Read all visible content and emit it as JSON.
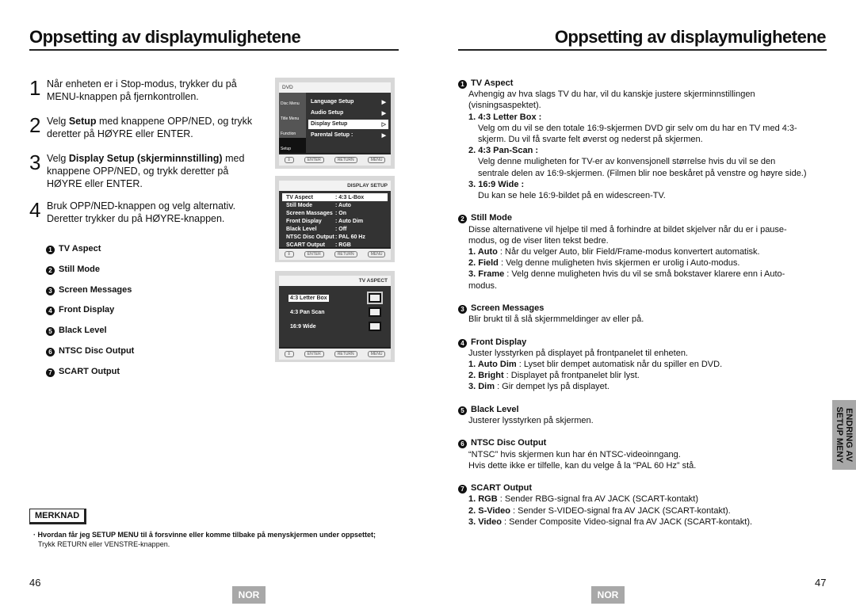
{
  "left": {
    "title": "Oppsetting av displaymulighetene",
    "steps": [
      {
        "n": "1",
        "pre": "Når enheten er i Stop-modus, trykker du på MENU-knappen på fjernkontrollen.",
        "bold": "",
        "post": ""
      },
      {
        "n": "2",
        "pre": "Velg ",
        "bold": "Setup",
        "post": " med knappene OPP/NED, og trykk deretter på HØYRE eller ENTER."
      },
      {
        "n": "3",
        "pre": "Velg ",
        "bold": "Display Setup (skjerminnstilling)",
        "post": " med knappene OPP/NED, og trykk deretter på HØYRE eller ENTER."
      },
      {
        "n": "4",
        "pre": "Bruk OPP/NED-knappen og velg alternativ. Deretter trykker du på HØYRE-knappen.",
        "bold": "",
        "post": ""
      }
    ],
    "items": [
      {
        "n": "1",
        "label": "TV Aspect"
      },
      {
        "n": "2",
        "label": "Still Mode"
      },
      {
        "n": "3",
        "label": "Screen Messages"
      },
      {
        "n": "4",
        "label": "Front Display"
      },
      {
        "n": "5",
        "label": "Black Level"
      },
      {
        "n": "6",
        "label": "NTSC Disc Output"
      },
      {
        "n": "7",
        "label": "SCART Output"
      }
    ],
    "note_label": "MERKNAD",
    "note_bold": "Hvordan får jeg SETUP MENU til å forsvinne eller komme tilbake på menyskjermen under oppsettet;",
    "note_text": "Trykk RETURN eller VENSTRE-knappen.",
    "page_number": "46",
    "lang_badge": "NOR"
  },
  "screens": {
    "footer": [
      "ENTER",
      "RETURN",
      "MENU"
    ],
    "setup": {
      "header": "DVD",
      "side": [
        "Disc Menu",
        "Title Menu",
        "Function",
        "Setup"
      ],
      "menu": [
        "Language Setup",
        "Audio Setup",
        "Display Setup",
        "Parental Setup :"
      ]
    },
    "display": {
      "header": "DISPLAY SETUP",
      "rows": [
        {
          "k": "TV Aspect",
          "v": ": 4:3 L-Box"
        },
        {
          "k": "Still Mode",
          "v": ": Auto"
        },
        {
          "k": "Screen Massages",
          "v": ": On"
        },
        {
          "k": "Front Display",
          "v": ": Auto Dim"
        },
        {
          "k": "Black Level",
          "v": ": Off"
        },
        {
          "k": "NTSC Disc Output",
          "v": ": PAL 60 Hz"
        },
        {
          "k": "SCART Output",
          "v": ": RGB"
        }
      ]
    },
    "aspect": {
      "header": "TV ASPECT",
      "options": [
        "4:3 Letter Box",
        "4:3 Pan Scan",
        "16:9 Wide"
      ]
    }
  },
  "right": {
    "title": "Oppsetting av displaymulighetene",
    "sections": [
      {
        "n": "1",
        "h": "TV Aspect",
        "p": "Avhengig av hva slags TV du har, vil du kanskje justere skjerminnstillingen (visningsaspektet).",
        "subs": [
          {
            "h": "1. 4:3 Letter Box :",
            "p": "Velg om du vil se den totale 16:9-skjermen DVD gir selv om du har en TV med 4:3-skjerm. Du vil få svarte felt øverst og nederst på skjermen."
          },
          {
            "h": "2. 4:3 Pan-Scan :",
            "p": "Velg denne muligheten for TV-er av konvensjonell størrelse hvis du vil se den sentrale delen av 16:9-skjermen. (Filmen blir noe beskåret på venstre og høyre side.)"
          },
          {
            "h": "3. 16:9 Wide :",
            "p": "Du kan se hele 16:9-bildet på en widescreen-TV."
          }
        ]
      },
      {
        "n": "2",
        "h": "Still Mode",
        "p": "Disse alternativene vil hjelpe til med å forhindre at bildet skjelver når du er i pause-modus, og de viser liten tekst bedre.",
        "list": [
          {
            "b": "1. Auto",
            "t": " : Når du velger Auto, blir Field/Frame-modus konvertert automatisk."
          },
          {
            "b": "2. Field",
            "t": " : Velg denne muligheten hvis skjermen er urolig i Auto-modus."
          },
          {
            "b": "3. Frame",
            "t": " : Velg denne muligheten hvis du vil se små bokstaver klarere enn i Auto-modus."
          }
        ]
      },
      {
        "n": "3",
        "h": "Screen Messages",
        "p": "Blir brukt til å slå skjermmeldinger av eller på."
      },
      {
        "n": "4",
        "h": "Front Display",
        "p": "Juster lysstyrken på displayet på frontpanelet til enheten.",
        "list": [
          {
            "b": "1. Auto Dim",
            "t": " :  Lyset blir dempet automatisk når du spiller en DVD."
          },
          {
            "b": "2. Bright",
            "t": " : Displayet på frontpanelet blir lyst."
          },
          {
            "b": "3. Dim",
            "t": " : Gir dempet lys på displayet."
          }
        ]
      },
      {
        "n": "5",
        "h": "Black Level",
        "p": "Justerer lysstyrken på skjermen."
      },
      {
        "n": "6",
        "h": "NTSC Disc Output",
        "p": "“NTSC” hvis skjermen kun har én NTSC-videoinngang.",
        "p2": "Hvis dette ikke er tilfelle, kan du velge å la “PAL 60 Hz” stå."
      },
      {
        "n": "7",
        "h": "SCART Output",
        "list": [
          {
            "b": "1. RGB",
            "t": " : Sender RBG-signal fra AV JACK (SCART-kontakt)"
          },
          {
            "b": "2. S-Video",
            "t": " : Sender S-VIDEO-signal fra AV JACK (SCART-kontakt)."
          },
          {
            "b": "3. Video",
            "t": " : Sender Composite Video-signal fra AV JACK (SCART-kontakt)."
          }
        ]
      }
    ],
    "side_tab": [
      "ENDRING AV",
      "SETUP MENY"
    ],
    "page_number": "47",
    "lang_badge": "NOR"
  }
}
